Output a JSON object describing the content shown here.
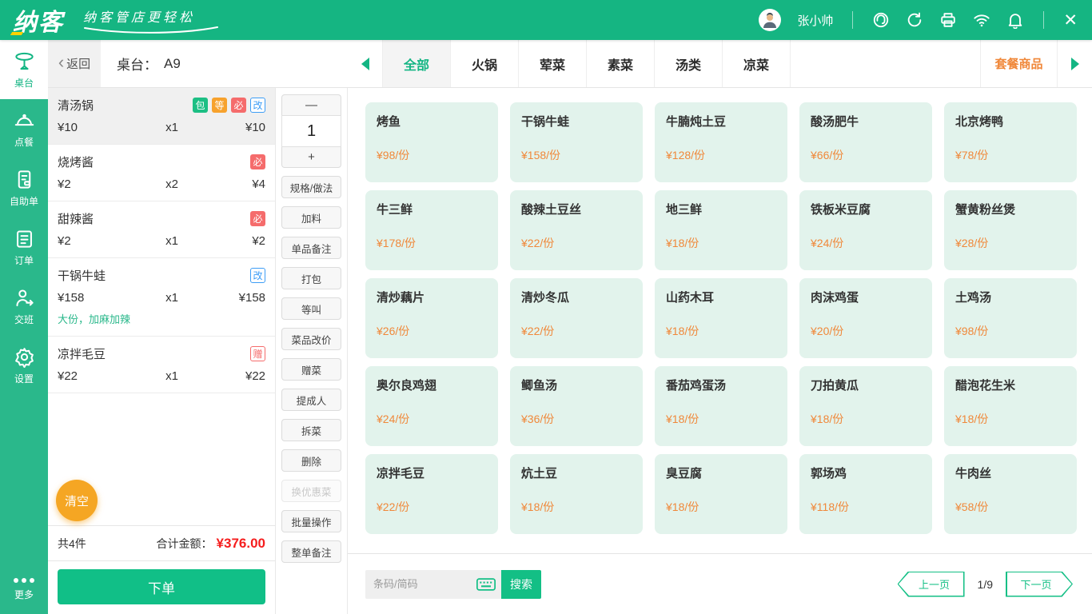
{
  "topbar": {
    "logo_text": "纳客",
    "slogan": "纳客管店更轻松",
    "user": "张小帅"
  },
  "sidebar": {
    "items": [
      {
        "label": "桌台",
        "slug": "tables",
        "icon": "table-icon",
        "active": true
      },
      {
        "label": "点餐",
        "slug": "ordering",
        "icon": "cloche-icon",
        "active": false
      },
      {
        "label": "自助单",
        "slug": "self-order",
        "icon": "device-icon",
        "active": false
      },
      {
        "label": "订单",
        "slug": "orders",
        "icon": "clipboard-icon",
        "active": false
      },
      {
        "label": "交班",
        "slug": "shift",
        "icon": "shift-icon",
        "active": false
      },
      {
        "label": "设置",
        "slug": "settings",
        "icon": "gear-icon",
        "active": false
      }
    ],
    "more_label": "更多"
  },
  "header": {
    "back_label": "返回",
    "table_label": "桌台：",
    "table_value": "A9",
    "tabs": [
      {
        "label": "全部",
        "slug": "all",
        "active": true
      },
      {
        "label": "火锅",
        "slug": "hotpot",
        "active": false
      },
      {
        "label": "荤菜",
        "slug": "meat",
        "active": false
      },
      {
        "label": "素菜",
        "slug": "vegetable",
        "active": false
      },
      {
        "label": "汤类",
        "slug": "soup",
        "active": false
      },
      {
        "label": "凉菜",
        "slug": "cold",
        "active": false
      }
    ],
    "combo_label": "套餐商品"
  },
  "order": {
    "items": [
      {
        "name": "清汤锅",
        "unit_price": "¥10",
        "qty": "x1",
        "total": "¥10",
        "selected": true,
        "note": "",
        "badges": [
          {
            "text": "包",
            "style": "solid-green"
          },
          {
            "text": "等",
            "style": "solid-orange"
          },
          {
            "text": "必",
            "style": "solid-red"
          },
          {
            "text": "改",
            "style": "outline-blue"
          }
        ]
      },
      {
        "name": "烧烤酱",
        "unit_price": "¥2",
        "qty": "x2",
        "total": "¥4",
        "selected": false,
        "note": "",
        "badges": [
          {
            "text": "必",
            "style": "solid-red"
          }
        ]
      },
      {
        "name": "甜辣酱",
        "unit_price": "¥2",
        "qty": "x1",
        "total": "¥2",
        "selected": false,
        "note": "",
        "badges": [
          {
            "text": "必",
            "style": "solid-red"
          }
        ]
      },
      {
        "name": "干锅牛蛙",
        "unit_price": "¥158",
        "qty": "x1",
        "total": "¥158",
        "selected": false,
        "note": "大份，加麻加辣",
        "badges": [
          {
            "text": "改",
            "style": "outline-blue"
          }
        ]
      },
      {
        "name": "凉拌毛豆",
        "unit_price": "¥22",
        "qty": "x1",
        "total": "¥22",
        "selected": false,
        "note": "",
        "badges": [
          {
            "text": "赠",
            "style": "outline-red"
          }
        ]
      }
    ],
    "clear_label": "清空",
    "count_text": "共4件",
    "total_label": "合计金额：",
    "total_value": "¥376.00",
    "submit_label": "下单"
  },
  "actions": {
    "minus_label": "—",
    "qty_value": "1",
    "plus_label": "+",
    "buttons": [
      {
        "label": "规格/做法",
        "disabled": false
      },
      {
        "label": "加料",
        "disabled": false
      },
      {
        "label": "单品备注",
        "disabled": false
      },
      {
        "label": "打包",
        "disabled": false
      },
      {
        "label": "等叫",
        "disabled": false
      },
      {
        "label": "菜品改价",
        "disabled": false
      },
      {
        "label": "赠菜",
        "disabled": false
      },
      {
        "label": "提成人",
        "disabled": false
      },
      {
        "label": "拆菜",
        "disabled": false
      },
      {
        "label": "删除",
        "disabled": false
      },
      {
        "label": "换优惠菜",
        "disabled": true
      },
      {
        "label": "批量操作",
        "disabled": false
      },
      {
        "label": "整单备注",
        "disabled": false
      }
    ]
  },
  "menu": {
    "items": [
      {
        "name": "烤鱼",
        "price": "¥98/份"
      },
      {
        "name": "干锅牛蛙",
        "price": "¥158/份"
      },
      {
        "name": "牛腩炖土豆",
        "price": "¥128/份"
      },
      {
        "name": "酸汤肥牛",
        "price": "¥66/份"
      },
      {
        "name": "北京烤鸭",
        "price": "¥78/份"
      },
      {
        "name": "牛三鲜",
        "price": "¥178/份"
      },
      {
        "name": "酸辣土豆丝",
        "price": "¥22/份"
      },
      {
        "name": "地三鲜",
        "price": "¥18/份"
      },
      {
        "name": "铁板米豆腐",
        "price": "¥24/份"
      },
      {
        "name": "蟹黄粉丝煲",
        "price": "¥28/份"
      },
      {
        "name": "清炒藕片",
        "price": "¥26/份"
      },
      {
        "name": "清炒冬瓜",
        "price": "¥22/份"
      },
      {
        "name": "山药木耳",
        "price": "¥18/份"
      },
      {
        "name": "肉沫鸡蛋",
        "price": "¥20/份"
      },
      {
        "name": "土鸡汤",
        "price": "¥98/份"
      },
      {
        "name": "奥尔良鸡翅",
        "price": "¥24/份"
      },
      {
        "name": "鲫鱼汤",
        "price": "¥36/份"
      },
      {
        "name": "番茄鸡蛋汤",
        "price": "¥18/份"
      },
      {
        "name": "刀拍黄瓜",
        "price": "¥18/份"
      },
      {
        "name": "醋泡花生米",
        "price": "¥18/份"
      },
      {
        "name": "凉拌毛豆",
        "price": "¥22/份"
      },
      {
        "name": "炕土豆",
        "price": "¥18/份"
      },
      {
        "name": "臭豆腐",
        "price": "¥18/份"
      },
      {
        "name": "郭场鸡",
        "price": "¥118/份"
      },
      {
        "name": "牛肉丝",
        "price": "¥58/份"
      }
    ]
  },
  "searchbar": {
    "placeholder": "条码/简码",
    "search_label": "搜索",
    "prev_label": "上一页",
    "page_text": "1/9",
    "next_label": "下一页"
  },
  "colors": {
    "topbar_green": "#15b582",
    "sidebar_green": "#2ab88b",
    "accent_green": "#13b583",
    "button_green": "#11bf87",
    "price_orange": "#f0883a",
    "clear_orange": "#f5a623",
    "total_red": "#f51d1d",
    "card_mint": "#e2f3ec"
  }
}
